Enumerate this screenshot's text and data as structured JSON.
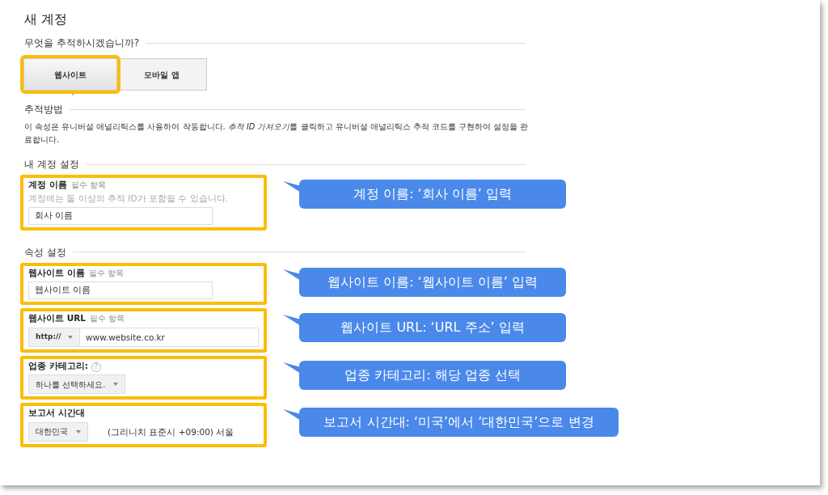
{
  "title": "새 계정",
  "track": {
    "heading": "무엇을 추적하시겠습니까?",
    "options": [
      {
        "label": "웹사이트",
        "selected": true,
        "highlighted": true
      },
      {
        "label": "모바일 앱",
        "selected": false,
        "highlighted": false
      }
    ]
  },
  "method": {
    "heading": "추적방법",
    "description": [
      {
        "text": "이 속성은 유니버설 애널리틱스를 사용하여 작동합니다. ",
        "italic": false
      },
      {
        "text": "추적 ID 가져오기",
        "italic": true
      },
      {
        "text": "를 클릭하고 유니버설 애널리틱스 추적 코드를 구현하여 설정을 완료합니다.",
        "italic": false
      }
    ]
  },
  "groups": [
    {
      "heading": "내 계정 설정",
      "fields": [
        {
          "kind": "text",
          "label": "계정 이름",
          "required": "필수 항목",
          "hint": "계정에는 둘 이상의 추적 ID가 포함될 수 있습니다.",
          "value": "회사 이름",
          "highlighted": true,
          "callout": "계정 이름: ‘회사 이름’ 입력"
        }
      ]
    },
    {
      "heading": "속성 설정",
      "fields": [
        {
          "kind": "text",
          "label": "웹사이트 이름",
          "required": "필수 항목",
          "value": "웹사이트 이름",
          "highlighted": true,
          "callout": "웹사이트 이름: ‘웹사이트 이름’ 입력"
        },
        {
          "kind": "url",
          "label": "웹사이트 URL",
          "required": "필수 항목",
          "protocol": "http://",
          "value": "www.website.co.kr",
          "highlighted": true,
          "callout": "웹사이트 URL: ‘URL 주소’ 입력"
        },
        {
          "kind": "select",
          "label": "업종 카테고리:",
          "help": "?",
          "value": "하나를 선택하세요.",
          "highlighted": true,
          "callout": "업종 카테고리: 해당 업종 선택"
        },
        {
          "kind": "timezone",
          "label": "보고서 시간대",
          "value": "대한민국",
          "note": "(그리니치 표준시 +09:00) 서울",
          "highlighted": true,
          "callout": "보고서 시간대: ‘미국’에서 ‘대한민국’으로 변경"
        }
      ]
    }
  ]
}
